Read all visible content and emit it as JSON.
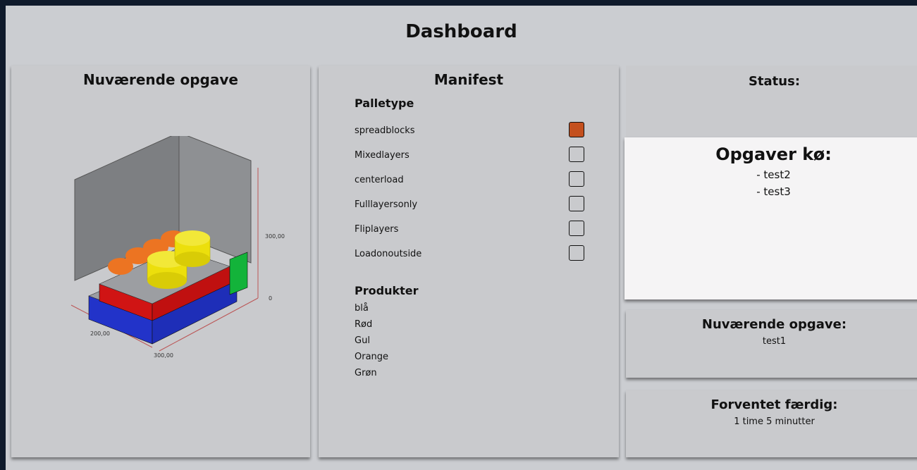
{
  "page": {
    "title": "Dashboard"
  },
  "current_task_panel": {
    "title": "Nuværende opgave",
    "visualization": {
      "axis_labels": {
        "height": "300,00",
        "origin": "0",
        "width": "200,00",
        "depth": "300,00"
      },
      "colors": {
        "blue": "#2233c9",
        "red": "#d01414",
        "green": "#13b33a",
        "orange": "#ec7422",
        "yellow": "#ecdf0c",
        "grey": "#9c9ea2"
      }
    }
  },
  "manifest": {
    "title": "Manifest",
    "pallet_type_title": "Palletype",
    "pallet_types": [
      {
        "label": "spreadblocks",
        "checked": true
      },
      {
        "label": "Mixedlayers",
        "checked": false
      },
      {
        "label": "centerload",
        "checked": false
      },
      {
        "label": "Fulllayersonly",
        "checked": false
      },
      {
        "label": "Fliplayers",
        "checked": false
      },
      {
        "label": "Loadonoutside",
        "checked": false
      }
    ],
    "products_title": "Produkter",
    "products": [
      "blå",
      "Rød",
      "Gul",
      "Orange",
      "Grøn"
    ]
  },
  "status": {
    "title": "Status:"
  },
  "queue": {
    "title": "Opgaver kø:",
    "items": [
      "- test2",
      "- test3"
    ]
  },
  "current": {
    "title": "Nuværende opgave:",
    "value": "test1"
  },
  "eta": {
    "title": "Forventet færdig:",
    "value": "1 time 5 minutter"
  },
  "accent_color": "#c4501e"
}
